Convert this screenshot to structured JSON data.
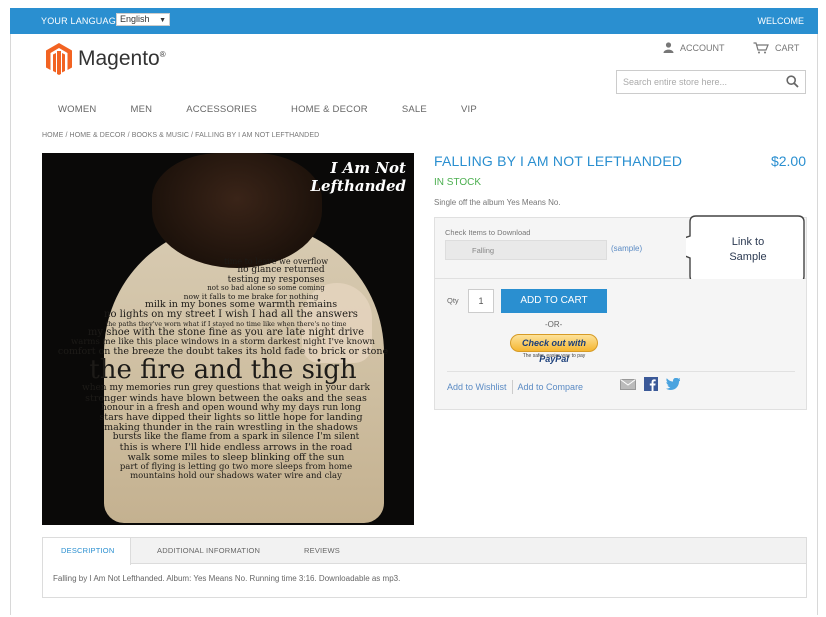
{
  "topbar": {
    "language_label": "YOUR LANGUAGE",
    "language_value": "English",
    "welcome": "WELCOME"
  },
  "header": {
    "logo_text": "Magento",
    "logo_mark": "®",
    "account": "ACCOUNT",
    "cart": "CART",
    "search_placeholder": "Search entire store here..."
  },
  "nav": [
    "WOMEN",
    "MEN",
    "ACCESSORIES",
    "HOME & DECOR",
    "SALE",
    "VIP"
  ],
  "breadcrumb": "HOME / HOME & DECOR / BOOKS & MUSIC / FALLING BY I AM NOT LEFTHANDED",
  "album": {
    "title_line1": "I Am Not",
    "title_line2": "Lefthanded",
    "lyrics": [
      "time to leave we overflow",
      "no glance returned",
      "testing my responses",
      "not so bad alone so some coming",
      "now it falls to me brake for nothing",
      "milk in my bones some warmth remains",
      "no lights on my street I wish I had all the answers",
      "the paths they've worn what if I stayed no time like when there's no time",
      "my shoe with the stone fine as you are late night drive",
      "warms me like this place windows in a storm darkest night I've known",
      "comfort on the breeze the doubt takes its hold fade to brick or stone",
      "the fire and the sigh",
      "when my memories run grey questions that weigh in your dark",
      "stronger winds have blown between the oaks and the seas",
      "honour in a fresh and open wound why my days run long",
      "stars have dipped their lights so little hope for landing",
      "making thunder in the rain wrestling in the shadows",
      "bursts like the flame from a spark in silence I'm silent",
      "this is where I'll hide endless arrows in the road",
      "walk some miles to sleep blinking off the sun",
      "part of flying is letting go two more sleeps from home",
      "mountains hold our shadows water wire and clay"
    ]
  },
  "product": {
    "name": "FALLING BY I AM NOT LEFTHANDED",
    "price": "$2.00",
    "stock": "IN STOCK",
    "short_description": "Single off the album Yes Means No.",
    "downloads_label": "Check Items to Download",
    "download_item": "Falling",
    "sample_link": "(sample)",
    "qty_label": "Qty",
    "qty_value": "1",
    "add_to_cart": "ADD TO CART",
    "or_text": "-OR-",
    "paypal_text": "Check out with PayPal",
    "paypal_sub": "The safer, easier way to pay",
    "add_to_wishlist": "Add to Wishlist",
    "add_to_compare": "Add to Compare"
  },
  "callout": {
    "line1": "Link to",
    "line2": "Sample"
  },
  "tabs": {
    "items": [
      "DESCRIPTION",
      "ADDITIONAL INFORMATION",
      "REVIEWS"
    ],
    "description_text": "Falling by I Am Not Lefthanded. Album: Yes Means No. Running time 3:16. Downloadable as mp3."
  },
  "colors": {
    "accent": "#2a8fd0",
    "stock_green": "#4caf50",
    "link": "#5b8bc4",
    "logo_orange": "#f26322"
  }
}
